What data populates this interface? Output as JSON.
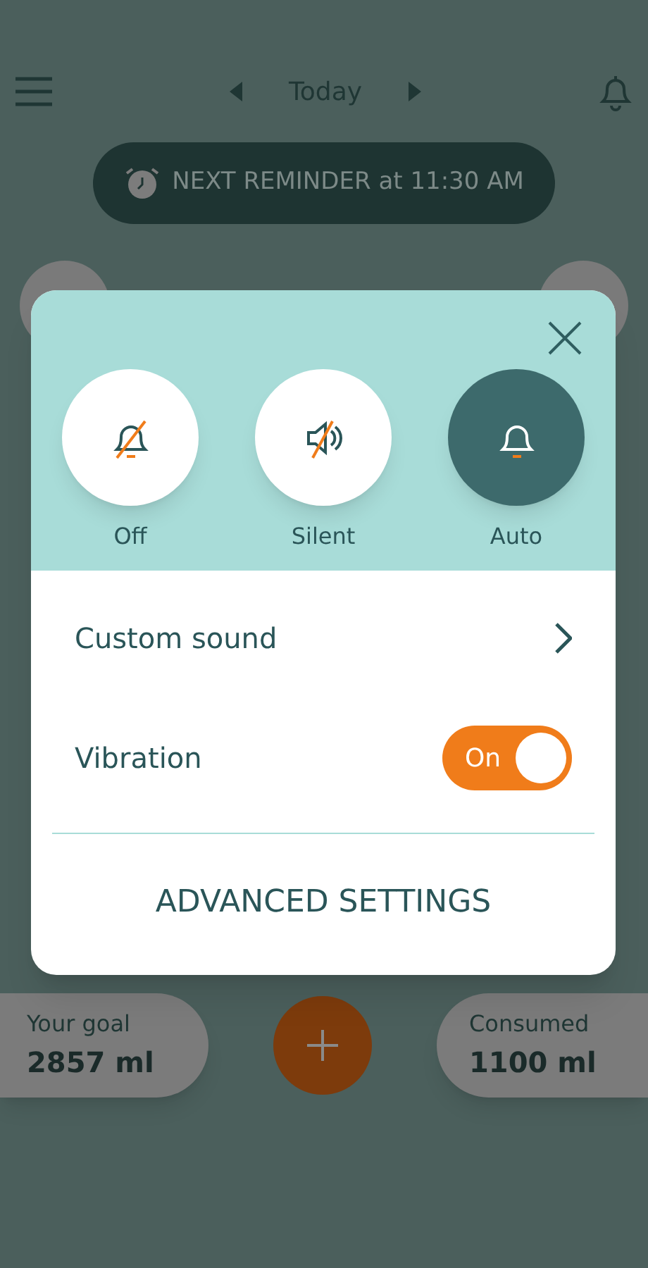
{
  "header": {
    "date": "Today"
  },
  "reminder": {
    "text": "NEXT REMINDER at 11:30 AM"
  },
  "dialog": {
    "modes": [
      {
        "kind": "off",
        "label": "Off",
        "selected": false
      },
      {
        "kind": "silent",
        "label": "Silent",
        "selected": false
      },
      {
        "kind": "auto",
        "label": "Auto",
        "selected": true
      }
    ],
    "custom_sound": {
      "label": "Custom sound"
    },
    "vibration": {
      "label": "Vibration",
      "on": true,
      "state_text": "On"
    },
    "advanced": {
      "label": "ADVANCED SETTINGS"
    }
  },
  "goal": {
    "label": "Your goal",
    "value": "2857 ml"
  },
  "consumed": {
    "label": "Consumed",
    "value": "1100 ml"
  }
}
